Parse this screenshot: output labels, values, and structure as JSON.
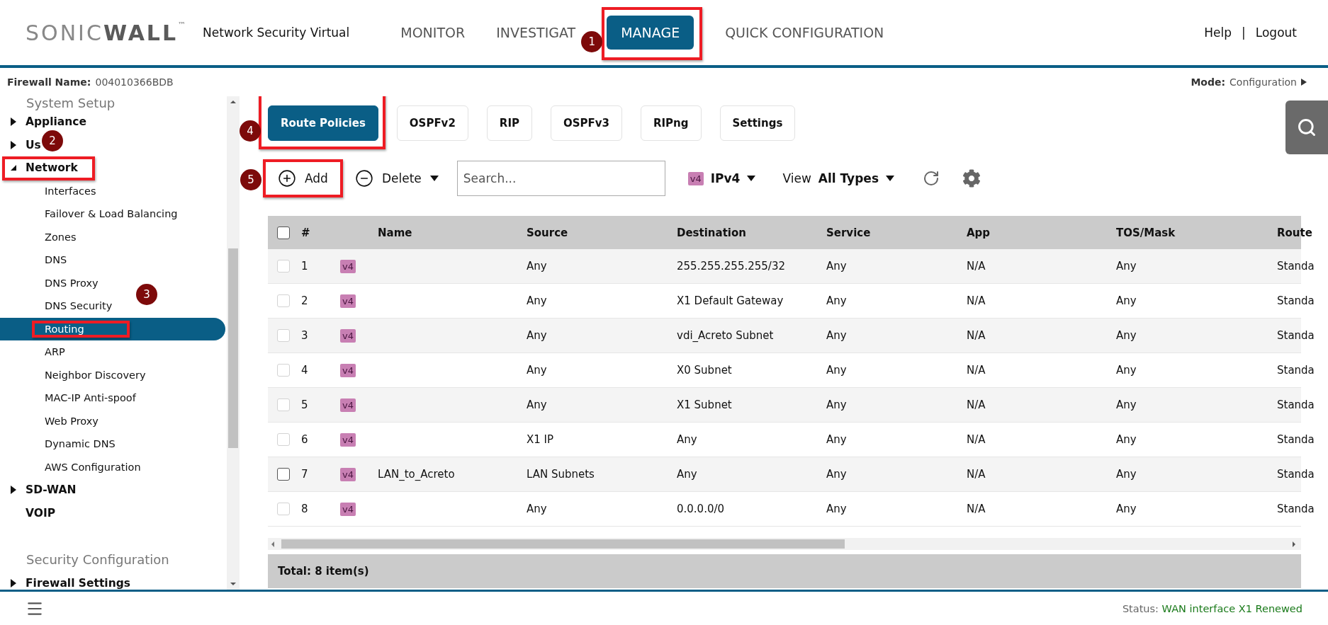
{
  "header": {
    "brand": [
      "SONIC",
      "WALL"
    ],
    "trademark": "™",
    "product": "Network Security Virtual",
    "nav": [
      {
        "label": "MONITOR",
        "selected": false,
        "highlighted": false
      },
      {
        "label": "INVESTIGAT",
        "selected": false,
        "highlighted": false
      },
      {
        "label": "MANAGE",
        "selected": true,
        "highlighted": true,
        "callout": "1"
      },
      {
        "label": "QUICK CONFIGURATION",
        "selected": false,
        "highlighted": false
      }
    ],
    "links": [
      "Help",
      "Logout"
    ],
    "separator": "|"
  },
  "info": {
    "firewall_label": "Firewall Name:",
    "firewall_name": "004010366BDB",
    "mode_label": "Mode:",
    "mode": "Configuration"
  },
  "sidebar": {
    "sections": [
      {
        "label": "System Setup",
        "items": [
          {
            "label": "Appliance",
            "kind": "folder",
            "expanded": false,
            "highlighted": false
          },
          {
            "label": "Us",
            "kind": "folder",
            "expanded": false,
            "highlighted": false
          },
          {
            "label": "Network",
            "kind": "folder",
            "expanded": true,
            "highlighted": true,
            "callout": "2",
            "children": [
              {
                "label": "Interfaces",
                "selected": false,
                "highlighted": false
              },
              {
                "label": "Failover & Load Balancing",
                "selected": false,
                "highlighted": false
              },
              {
                "label": "Zones",
                "selected": false,
                "highlighted": false
              },
              {
                "label": "DNS",
                "selected": false,
                "highlighted": false
              },
              {
                "label": "DNS Proxy",
                "selected": false,
                "highlighted": false
              },
              {
                "label": "DNS Security",
                "selected": false,
                "highlighted": false
              },
              {
                "label": "Routing",
                "selected": true,
                "highlighted": true,
                "callout": "3"
              },
              {
                "label": "ARP",
                "selected": false,
                "highlighted": false
              },
              {
                "label": "Neighbor Discovery",
                "selected": false,
                "highlighted": false
              },
              {
                "label": "MAC-IP Anti-spoof",
                "selected": false,
                "highlighted": false
              },
              {
                "label": "Web Proxy",
                "selected": false,
                "highlighted": false
              },
              {
                "label": "Dynamic DNS",
                "selected": false,
                "highlighted": false
              },
              {
                "label": "AWS Configuration",
                "selected": false,
                "highlighted": false
              }
            ]
          },
          {
            "label": "SD-WAN",
            "kind": "folder",
            "expanded": false,
            "highlighted": false
          },
          {
            "label": "VOIP",
            "kind": "page",
            "highlighted": false
          }
        ]
      },
      {
        "label": "Security Configuration",
        "items": [
          {
            "label": "Firewall Settings",
            "kind": "folder",
            "expanded": false,
            "highlighted": false
          }
        ]
      }
    ]
  },
  "subtabs": [
    {
      "label": "Route Policies",
      "selected": true,
      "highlighted": true,
      "callout": "4"
    },
    {
      "label": "OSPFv2",
      "selected": false,
      "highlighted": false
    },
    {
      "label": "RIP",
      "selected": false,
      "highlighted": false
    },
    {
      "label": "OSPFv3",
      "selected": false,
      "highlighted": false
    },
    {
      "label": "RIPng",
      "selected": false,
      "highlighted": false
    },
    {
      "label": "Settings",
      "selected": false,
      "highlighted": false
    }
  ],
  "toolbar": {
    "add": {
      "label": "Add",
      "highlighted": true,
      "callout": "5"
    },
    "delete": {
      "label": "Delete"
    },
    "search": {
      "placeholder": "Search..."
    },
    "ip_filter": {
      "badge": "v4",
      "label": "IPv4"
    },
    "view": {
      "label": "View",
      "value": "All Types"
    }
  },
  "table": {
    "select_all": {
      "checked": false
    },
    "columns": [
      "#",
      "Name",
      "Source",
      "Destination",
      "Service",
      "App",
      "TOS/Mask",
      "Route"
    ],
    "rows": [
      {
        "number": "1",
        "disabled": true,
        "ip_version": "v4",
        "source": "Any",
        "destination": "255.255.255.255/32",
        "service": "Any",
        "app": "N/A",
        "tos_mask": "Any",
        "route": "Standa"
      },
      {
        "number": "2",
        "disabled": true,
        "ip_version": "v4",
        "source": "Any",
        "destination": "X1 Default Gateway",
        "service": "Any",
        "app": "N/A",
        "tos_mask": "Any",
        "route": "Standa"
      },
      {
        "number": "3",
        "disabled": true,
        "ip_version": "v4",
        "source": "Any",
        "destination": "vdi_Acreto Subnet",
        "service": "Any",
        "app": "N/A",
        "tos_mask": "Any",
        "route": "Standa"
      },
      {
        "number": "4",
        "disabled": true,
        "ip_version": "v4",
        "source": "Any",
        "destination": "X0 Subnet",
        "service": "Any",
        "app": "N/A",
        "tos_mask": "Any",
        "route": "Standa"
      },
      {
        "number": "5",
        "disabled": true,
        "ip_version": "v4",
        "source": "Any",
        "destination": "X1 Subnet",
        "service": "Any",
        "app": "N/A",
        "tos_mask": "Any",
        "route": "Standa"
      },
      {
        "number": "6",
        "disabled": true,
        "ip_version": "v4",
        "source": "X1 IP",
        "destination": "Any",
        "service": "Any",
        "app": "N/A",
        "tos_mask": "Any",
        "route": "Standa"
      },
      {
        "number": "7",
        "disabled": false,
        "ip_version": "v4",
        "name": "LAN_to_Acreto",
        "source": "LAN Subnets",
        "destination": "Any",
        "service": "Any",
        "app": "N/A",
        "tos_mask": "Any",
        "route": "Standa"
      },
      {
        "number": "8",
        "disabled": true,
        "ip_version": "v4",
        "source": "Any",
        "destination": "0.0.0.0/0",
        "service": "Any",
        "app": "N/A",
        "tos_mask": "Any",
        "route": "Standa"
      }
    ],
    "total": "Total: 8 item(s)"
  },
  "status": {
    "label": "Status:",
    "value": "WAN interface X1 Renewed"
  }
}
